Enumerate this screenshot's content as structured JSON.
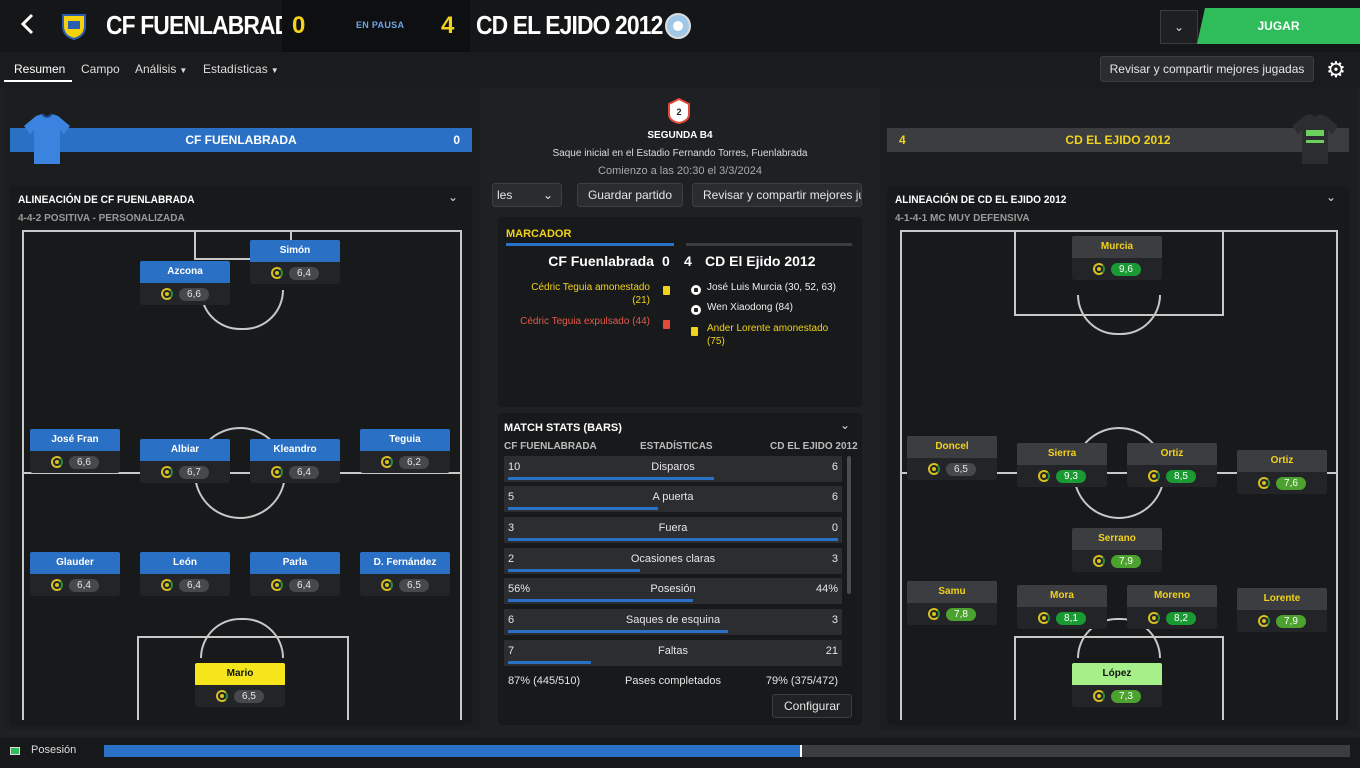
{
  "header": {
    "home_team": "CF FUENLABRADA",
    "away_team": "CD EL EJIDO 2012",
    "home_score": "0",
    "away_score": "4",
    "status": "EN PAUSA",
    "play_button": "JUGAR",
    "back_icon": "chevron-left-icon",
    "dropdown_icon": "chevron-down-icon"
  },
  "tabs": [
    {
      "label": "Resumen",
      "active": true
    },
    {
      "label": "Campo"
    },
    {
      "label": "Análisis"
    },
    {
      "label": "Estadísticas"
    }
  ],
  "toolbar": {
    "review_button": "Revisar y compartir mejores jugadas",
    "settings_icon": "gear-icon"
  },
  "match_info": {
    "competition": "SEGUNDA B4",
    "kickoff_text": "Saque inicial en el Estadio Fernando Torres, Fuenlabrada",
    "start_text": "Comienzo a las 20:30 el 3/3/2024",
    "partial_button": "les",
    "save_button": "Guardar partido",
    "review_button": "Revisar y compartir mejores ju"
  },
  "home": {
    "bar_name": "CF FUENLABRADA",
    "bar_score": "0",
    "lineup_title": "ALINEACIÓN DE CF FUENLABRADA",
    "formation": "4-4-2 POSITIVA - PERSONALIZADA",
    "players": [
      {
        "name": "Simón",
        "rating": "6,4"
      },
      {
        "name": "Azcona",
        "rating": "6,6"
      },
      {
        "name": "José Fran",
        "rating": "6,6"
      },
      {
        "name": "Albiar",
        "rating": "6,7"
      },
      {
        "name": "Kleandro",
        "rating": "6,4"
      },
      {
        "name": "Teguia",
        "rating": "6,2"
      },
      {
        "name": "Glauder",
        "rating": "6,4"
      },
      {
        "name": "León",
        "rating": "6,4"
      },
      {
        "name": "Parla",
        "rating": "6,4"
      },
      {
        "name": "D. Fernández",
        "rating": "6,5"
      },
      {
        "name": "Mario",
        "rating": "6,5"
      }
    ]
  },
  "away": {
    "bar_name": "CD EL EJIDO 2012",
    "bar_score": "4",
    "lineup_title": "ALINEACIÓN DE CD EL EJIDO 2012",
    "formation": "4-1-4-1 MC MUY DEFENSIVA",
    "players": [
      {
        "name": "Murcia",
        "rating": "9,6"
      },
      {
        "name": "Doncel",
        "rating": "6,5"
      },
      {
        "name": "Sierra",
        "rating": "9,3"
      },
      {
        "name": "Ortiz",
        "rating": "8,5"
      },
      {
        "name": "Ortiz",
        "rating": "7,6"
      },
      {
        "name": "Serrano",
        "rating": "7,9"
      },
      {
        "name": "Samu",
        "rating": "7,8"
      },
      {
        "name": "Mora",
        "rating": "8,1"
      },
      {
        "name": "Moreno",
        "rating": "8,2"
      },
      {
        "name": "Lorente",
        "rating": "7,9"
      },
      {
        "name": "López",
        "rating": "7,3"
      }
    ]
  },
  "scoreboard": {
    "title": "MARCADOR",
    "home_name": "CF Fuenlabrada",
    "home_score": "0",
    "away_score": "4",
    "away_name": "CD El Ejido 2012",
    "home_events": [
      "Cédric Teguia amonestado",
      "(21)",
      "Cédric Teguia expulsado (44)"
    ],
    "away_events": [
      "José Luis Murcia (30, 52, 63)",
      "Wen Xiaodong (84)",
      "Ander Lorente amonestado",
      "(75)"
    ]
  },
  "stats": {
    "title": "MATCH STATS (BARS)",
    "home_col": "CF FUENLABRADA",
    "mid_col": "ESTADÍSTICAS",
    "away_col": "CD EL EJIDO 2012",
    "rows": [
      {
        "home": "10",
        "label": "Disparos",
        "away": "6",
        "home_share": 0.625
      },
      {
        "home": "5",
        "label": "A puerta",
        "away": "6",
        "home_share": 0.455
      },
      {
        "home": "3",
        "label": "Fuera",
        "away": "0",
        "home_share": 1.0
      },
      {
        "home": "2",
        "label": "Ocasiones claras",
        "away": "3",
        "home_share": 0.4
      },
      {
        "home": "56%",
        "label": "Posesión",
        "away": "44%",
        "home_share": 0.56
      },
      {
        "home": "6",
        "label": "Saques de esquina",
        "away": "3",
        "home_share": 0.667
      },
      {
        "home": "7",
        "label": "Faltas",
        "away": "21",
        "home_share": 0.25
      },
      {
        "home": "87% (445/510)",
        "label": "Pases completados",
        "away": "79% (375/472)"
      }
    ],
    "configure_button": "Configurar"
  },
  "footer": {
    "label": "Posesión",
    "home_possession": 0.56
  },
  "colors": {
    "home": "#2a70c4",
    "away": "#f2d21b",
    "play": "#2fbd5b"
  }
}
